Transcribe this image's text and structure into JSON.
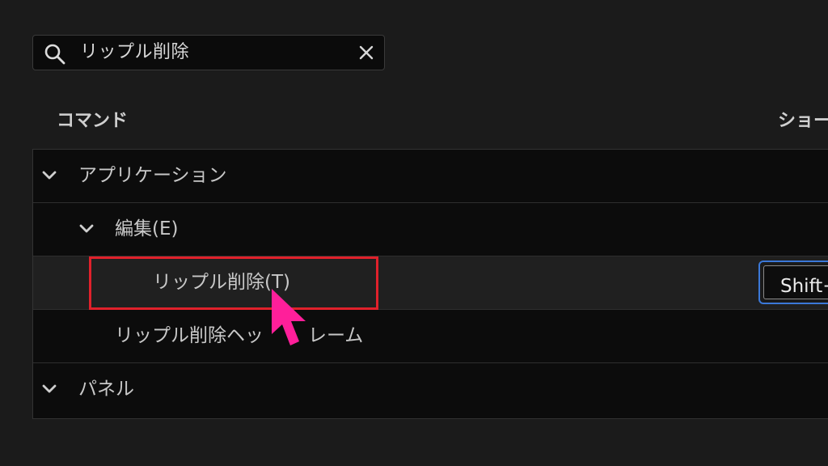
{
  "search": {
    "query": "リップル削除"
  },
  "columns": {
    "command": "コマンド",
    "shortcut": "ショー"
  },
  "tree": {
    "application": "アプリケーション",
    "edit_menu": "編集(E)",
    "ripple_delete": "リップル削除(T)",
    "ripple_delete_shortcut": "Shift+",
    "ripple_delete_head": "リップル削除ヘッ",
    "ripple_delete_head_tail": "レーム",
    "panel": "パネル"
  },
  "colors": {
    "highlight": "#e0212b",
    "cursor": "#ff1f9a",
    "focus": "#3b78d8"
  },
  "icons": {
    "search": "search-icon",
    "clear": "close-icon",
    "expand": "chevron-down-icon",
    "pointer": "mouse-cursor-icon"
  }
}
